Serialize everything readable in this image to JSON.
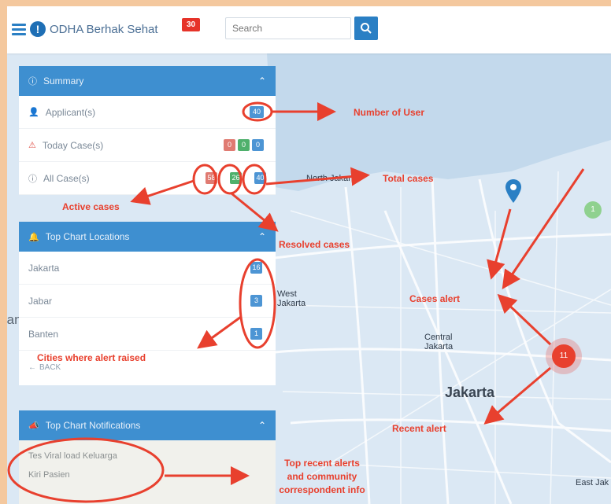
{
  "header": {
    "app_title": "ODHA Berhak Sehat",
    "title_badge": "30",
    "search_placeholder": "Search"
  },
  "summary_panel": {
    "title": "Summary",
    "rows": [
      {
        "label": "Applicant(s)",
        "badges": [
          "40"
        ]
      },
      {
        "label": "Today Case(s)",
        "badges": [
          "0",
          "0",
          "0"
        ]
      },
      {
        "label": "All Case(s)",
        "badges": [
          "58",
          "26",
          "40"
        ]
      }
    ]
  },
  "chart_locations_panel": {
    "title": "Top Chart Locations",
    "rows": [
      {
        "label": "Jakarta",
        "badge": "16"
      },
      {
        "label": "Jabar",
        "badge": "3"
      },
      {
        "label": "Banten",
        "badge": "1"
      }
    ],
    "back_label": "BACK"
  },
  "notifications_panel": {
    "title": "Top Chart Notifications",
    "items": [
      "Tes Viral load Keluarga",
      "Kiri Pasien"
    ]
  },
  "map": {
    "labels": {
      "north_jakarta": "North Jakarta",
      "west_jakarta": "West Jakarta",
      "central_jakarta": "Central Jakarta",
      "jakarta": "Jakarta",
      "east_jakarta": "East Jak",
      "rang": "rang"
    },
    "cluster_green_count": "1",
    "cluster_red_count": "11"
  },
  "annotations": {
    "number_of_user": "Number of User",
    "total_cases": "Total cases",
    "active_cases": "Active cases",
    "resolved_cases": "Resolved cases",
    "cities_alert": "Cities where alert raised",
    "cases_alert": "Cases alert",
    "recent_alert": "Recent alert",
    "top_recent_line1": "Top recent alerts",
    "top_recent_line2": "and community",
    "top_recent_line3": "correspondent info"
  },
  "colors": {
    "primary": "#2a7fc4",
    "panel_header": "#3e8fd0",
    "annotation_red": "#e8402e",
    "badge_red": "#e63329"
  }
}
